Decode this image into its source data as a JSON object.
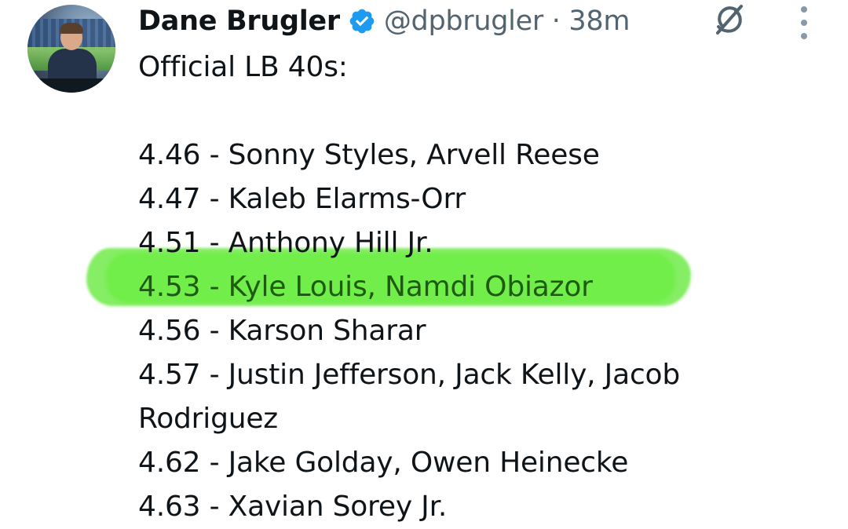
{
  "tweet": {
    "author_name": "Dane Brugler",
    "handle_time": "@dpbrugler · 38m",
    "lines": [
      "Official LB 40s:",
      "",
      "4.46 - Sonny Styles, Arvell Reese",
      "4.47 - Kaleb Elarms-Orr",
      "4.51 - Anthony Hill Jr.",
      "4.53 - Kyle Louis, Namdi Obiazor",
      "4.56 - Karson Sharar",
      "4.57 - Justin Jefferson, Jack Kelly, Jacob",
      "Rodriguez",
      "4.62 - Jake Golday, Owen Heinecke",
      "4.63 - Xavian Sorey Jr."
    ]
  },
  "colors": {
    "text": "#0f1419",
    "muted": "#536471",
    "verified_blue": "#1d9bf0",
    "highlight_green": "#56e828"
  },
  "icons": [
    "avatar",
    "verified-badge-icon",
    "grok-icon",
    "more-options-icon"
  ]
}
